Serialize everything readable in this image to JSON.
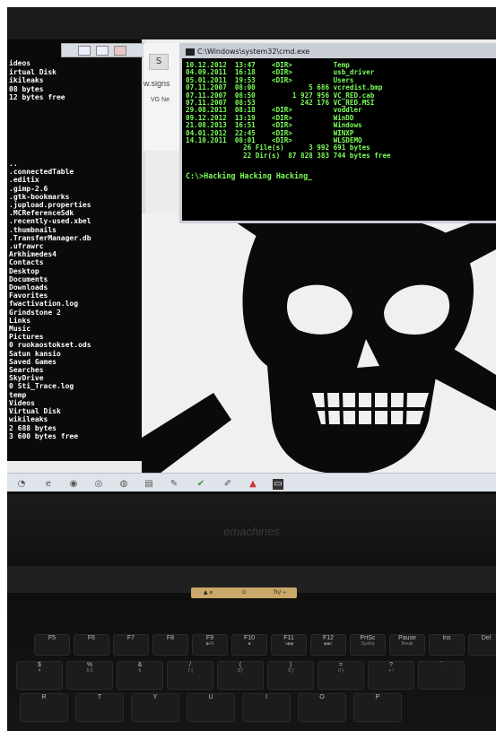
{
  "left_terminal": {
    "top_lines": [
      "ideos",
      "irtual Disk",
      "ikileaks",
      "08 bytes",
      "12 bytes free"
    ],
    "list_lines": [
      "..",
      ".connectedTable",
      ".editix",
      ".gimp-2.6",
      ".gtk-bookmarks",
      ".jupload.properties",
      ".MCReferenceSdk",
      ".recently-used.xbel",
      ".thumbnails",
      ".TransferManager.db",
      ".ufrawrc",
      "Arkhimedes4",
      "Contacts",
      "Desktop",
      "Documents",
      "Downloads",
      "Favorites",
      "fwactivation.log",
      "Grindstone 2",
      "Links",
      "Music",
      "Pictures",
      "0 ruokaostokset.ods",
      "Satun kansio",
      "Saved Games",
      "Searches",
      "SkyDrive",
      "0 Sti_Trace.log",
      "temp",
      "Videos",
      "Virtual Disk",
      "wikileaks",
      "2 688 bytes",
      "3 600 bytes free"
    ]
  },
  "browser": {
    "tab_label": "S",
    "url_fragment": "w.signs",
    "bookmark_fragment": "VG Ne"
  },
  "cmd": {
    "title": "C:\\Windows\\system32\\cmd.exe",
    "rows": [
      "10.12.2012  13:47    <DIR>          Temp",
      "04.09.2011  16:18    <DIR>          usb_driver",
      "05.01.2011  19:53    <DIR>          Users",
      "07.11.2007  08:00             5 686 vcredist.bmp",
      "07.11.2007  08:50         1 927 956 VC_RED.cab",
      "07.11.2007  08:53           242 176 VC_RED.MSI",
      "29.08.2013  08:18    <DIR>          voddler",
      "09.12.2012  13:19    <DIR>          WinDD",
      "21.08.2013  16:51    <DIR>          Windows",
      "04.01.2012  22:45    <DIR>          WINXP",
      "14.10.2011  08:01    <DIR>          WLSDEMO",
      "              26 File(s)      3 992 691 bytes",
      "              22 Dir(s)  87 828 383 744 bytes free"
    ],
    "prompt": "C:\\>Hacking Hacking Hacking_"
  },
  "taskbar": {
    "icons": [
      "ie-icon",
      "explorer-icon",
      "chrome-icon",
      "firefox-icon",
      "cmd-icon"
    ]
  },
  "laptop": {
    "brand": "emachines",
    "media_keys": [
      "▲ ⌀",
      "⏻",
      "fn/ ⌁"
    ],
    "function_keys": [
      {
        "label": "F5",
        "sub": ""
      },
      {
        "label": "F6",
        "sub": ""
      },
      {
        "label": "F7",
        "sub": ""
      },
      {
        "label": "F8",
        "sub": ""
      },
      {
        "label": "F9",
        "sub": "▶/II"
      },
      {
        "label": "F10",
        "sub": "■"
      },
      {
        "label": "F11",
        "sub": "I◀◀"
      },
      {
        "label": "F12",
        "sub": "▶▶I"
      },
      {
        "label": "PrtSc",
        "sub": "SysRq"
      },
      {
        "label": "Pause",
        "sub": "Break"
      },
      {
        "label": "Ins",
        "sub": ""
      },
      {
        "label": "Del",
        "sub": ""
      }
    ],
    "number_keys": [
      {
        "label": "$",
        "sub": "4"
      },
      {
        "label": "%",
        "sub": "5 €"
      },
      {
        "label": "&",
        "sub": "6"
      },
      {
        "label": "/",
        "sub": "7 {"
      },
      {
        "label": "(",
        "sub": "8 ["
      },
      {
        "label": ")",
        "sub": "9 ]"
      },
      {
        "label": "=",
        "sub": "0 }"
      },
      {
        "label": "?",
        "sub": "+ \\"
      },
      {
        "label": "`",
        "sub": "´"
      }
    ],
    "letter_keys": [
      "R",
      "T",
      "Y",
      "U",
      "I",
      "O",
      "P"
    ]
  }
}
